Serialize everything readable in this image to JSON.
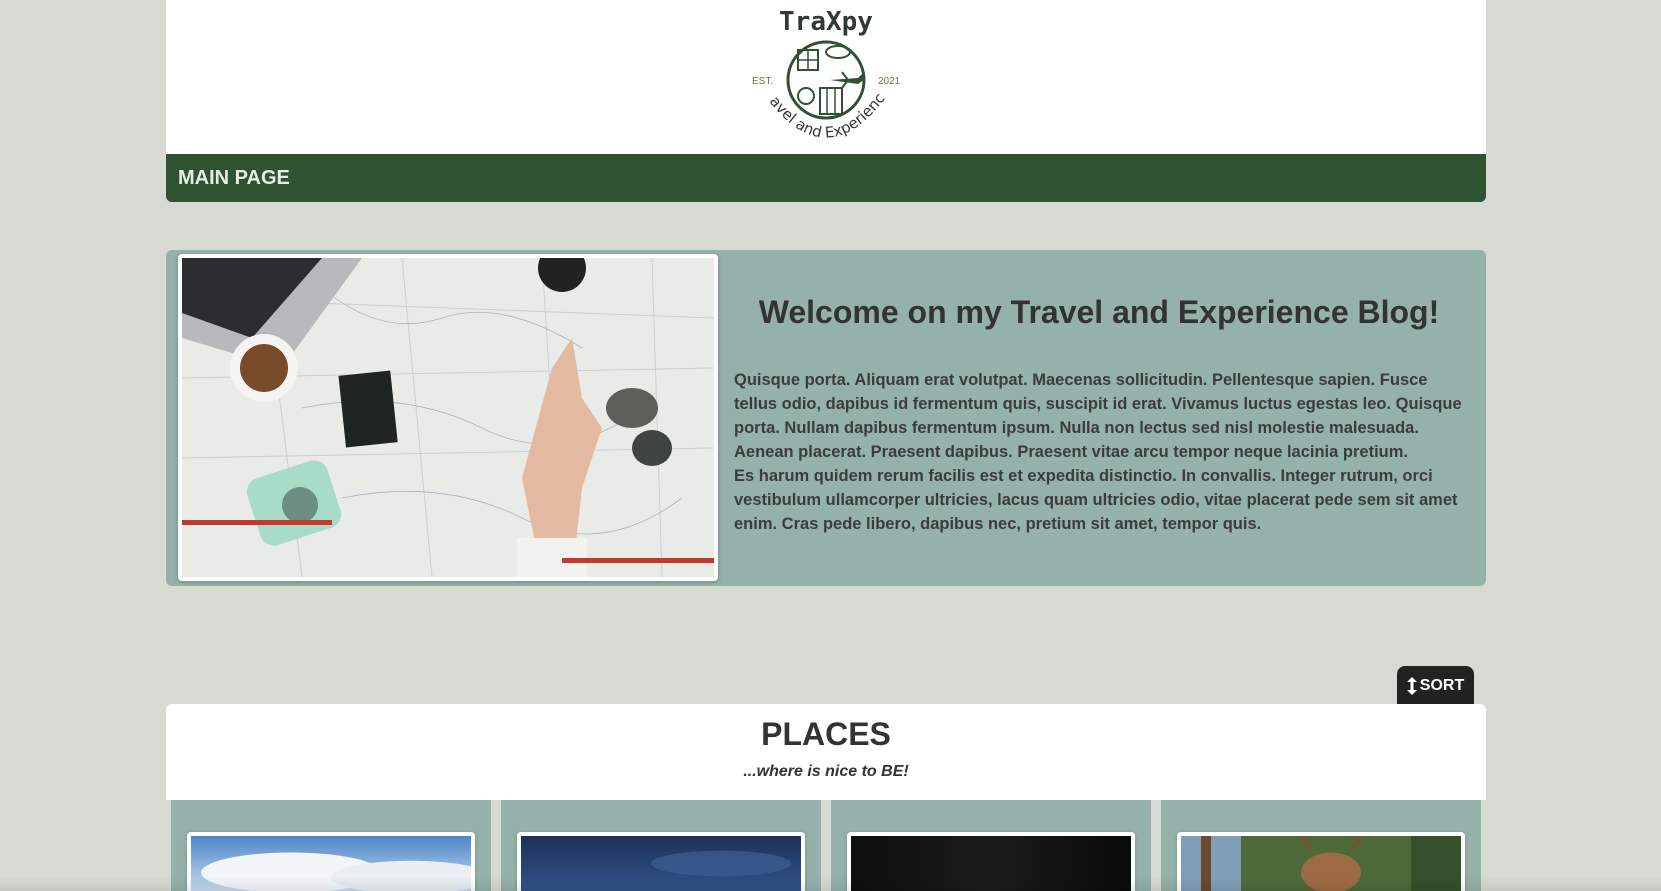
{
  "brand": {
    "name": "TraXpy",
    "tagline": "Travel and Experience",
    "est_label": "EST.",
    "est_year": "2021",
    "primary_color": "#2f5233",
    "secondary_color": "#94b2aa",
    "background_color": "#d6dad2"
  },
  "nav": {
    "items": [
      {
        "label": "MAIN PAGE"
      }
    ]
  },
  "welcome": {
    "title": "Welcome on my Travel and Experience Blog!",
    "paragraph_1": "Quisque porta. Aliquam erat volutpat. Maecenas sollicitudin. Pellentesque sapien. Fusce tellus odio, dapibus id fermentum quis, suscipit id erat. Vivamus luctus egestas leo. Quisque porta. Nullam dapibus fermentum ipsum. Nulla non lectus sed nisl molestie malesuada. Aenean placerat. Praesent dapibus. Praesent vitae arcu tempor neque lacinia pretium.",
    "paragraph_2": "Es harum quidem rerum facilis est et expedita distinctio. In convallis. Integer rutrum, orci vestibulum ullamcorper ultricies, lacus quam ultricies odio, vitae placerat pede sem sit amet enim. Cras pede libero, dapibus nec, pretium sit amet, tempor quis.",
    "image_icon": "travel-map-photo"
  },
  "sort": {
    "label": "SORT",
    "icon": "vertical-arrows-icon"
  },
  "places": {
    "title": "PLACES",
    "subtitle": "...where is nice to BE!",
    "cards": [
      {
        "image_icon": "sky-clouds-photo"
      },
      {
        "image_icon": "night-sky-photo"
      },
      {
        "image_icon": "dark-photo"
      },
      {
        "image_icon": "forest-deer-photo"
      }
    ]
  }
}
